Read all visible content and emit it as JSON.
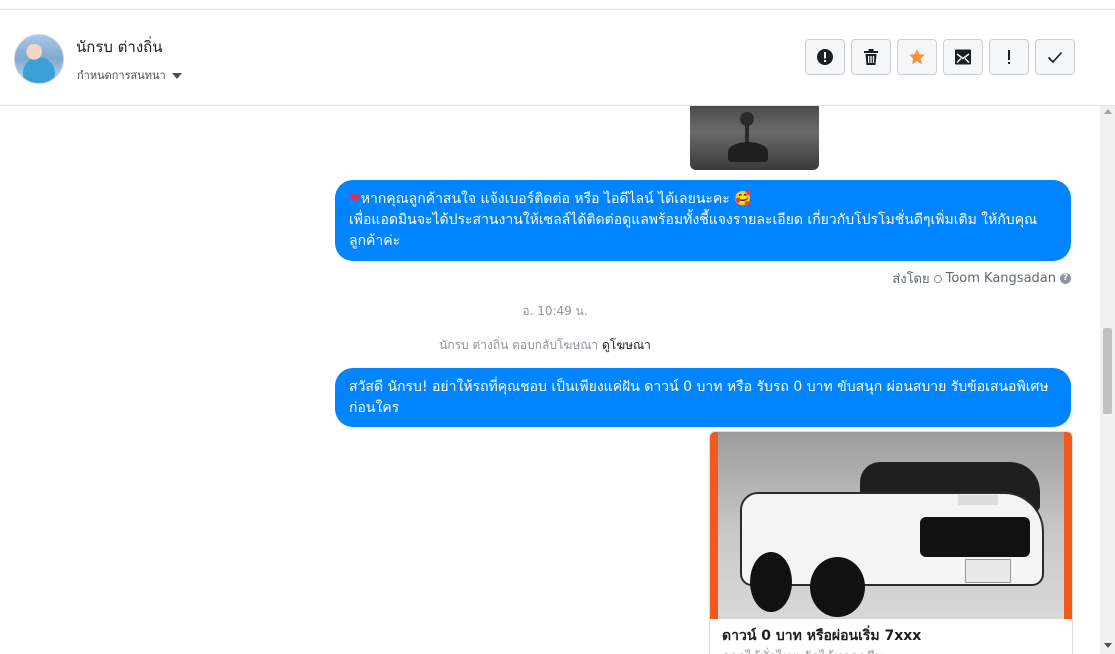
{
  "conversation": {
    "contact_name": "นักรบ ต่างถิ่น",
    "assign_label": "กำหนดการสนทนา"
  },
  "toolbar": {
    "buttons": [
      {
        "icon": "spam-alert-icon"
      },
      {
        "icon": "trash-icon"
      },
      {
        "icon": "star-icon",
        "color": "#f7923a"
      },
      {
        "icon": "mark-unread-icon"
      },
      {
        "icon": "follow-up-icon"
      },
      {
        "icon": "check-done-icon"
      }
    ]
  },
  "messages": {
    "msg1": {
      "line1": "หากคุณลูกค้าสนใจ แจ้งเบอร์ติดต่อ หรือ ไอดีไลน์ ได้เลยนะคะ 🥰",
      "line2": "เพื่อแอดมินจะได้ประสานงานให้เซลล์ได้ติดต่อดูแลพร้อมทั้งชี้แจงรายละเอียด เกี่ยวกับโปรโมชั่นดีๆเพิ่มเติม ให้กับคุณลูกค้าค่ะ"
    },
    "sent_by_prefix": "ส่งโดย",
    "sent_by_name": "Toom Kangsadan",
    "timestamp": "อ. 10:49 น.",
    "ad_reply_text": "นักรบ ต่างถิ่น ตอบกลับโฆษณา",
    "ad_reply_link": "ดูโฆษณา",
    "msg2": "สวัสดี นักรบ! อย่าให้รถที่คุณชอบ เป็นเพียงแค่ฝัน ดาวน์ 0 บาท หรือ รับรถ 0 บาท ขับสนุก ผ่อนสบาย รับข้อเสนอพิเศษก่อนใคร",
    "card": {
      "title": "ดาวน์ 0 บาท หรือผ่อนเริ่ม 7xxx",
      "subtitle": "ออกได้ทั่วไทย จัดได้ทุกอาชีพ"
    }
  },
  "colors": {
    "bubble": "#0084ff",
    "accent_star": "#f7923a"
  }
}
